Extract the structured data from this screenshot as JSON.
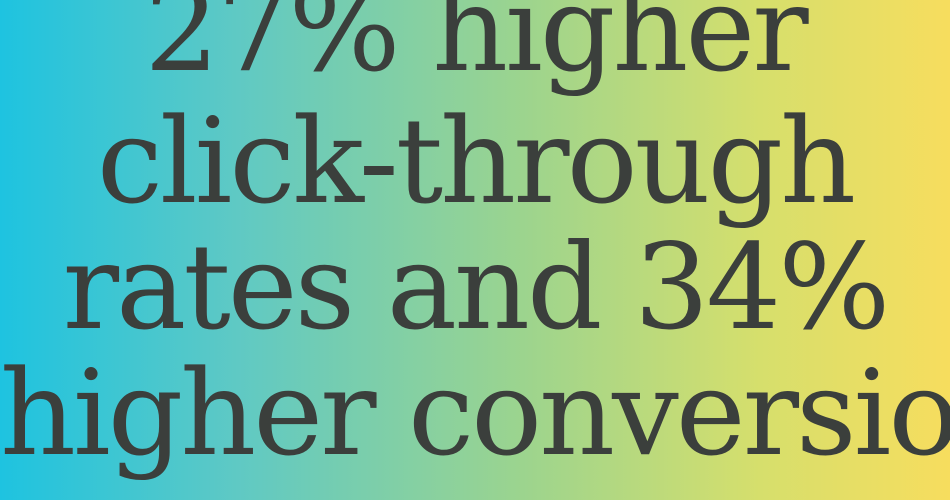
{
  "headline": {
    "line1": "27% higher",
    "line2": "click-through",
    "line3": "rates and 34%",
    "line4": "higher conversion"
  },
  "colors": {
    "gradient_left": "#1ec3e0",
    "gradient_mid": "#9cd48e",
    "gradient_right": "#f7dd5e",
    "text": "#3b3f3c"
  }
}
